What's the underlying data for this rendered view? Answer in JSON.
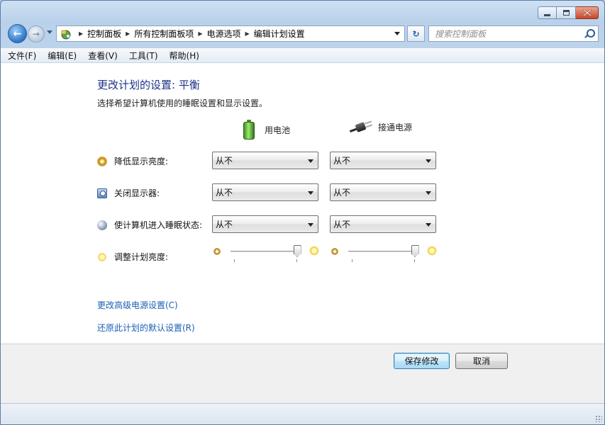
{
  "window": {
    "caption_buttons": [
      "minimize-icon",
      "maximize-icon",
      "close-icon"
    ]
  },
  "nav": {
    "back_icon": "back-arrow-icon",
    "forward_icon": "forward-arrow-icon",
    "breadcrumb": [
      "控制面板",
      "所有控制面板项",
      "电源选项",
      "编辑计划设置"
    ],
    "search_placeholder": "搜索控制面板"
  },
  "menu": [
    "文件(F)",
    "编辑(E)",
    "查看(V)",
    "工具(T)",
    "帮助(H)"
  ],
  "page": {
    "title": "更改计划的设置: 平衡",
    "subtitle": "选择希望计算机使用的睡眠设置和显示设置。",
    "col_battery": "用电池",
    "col_plugged": "接通电源"
  },
  "settings": [
    {
      "label": "降低显示亮度:",
      "icon": "dim-display-icon",
      "battery": "从不",
      "plugged": "从不"
    },
    {
      "label": "关闭显示器:",
      "icon": "monitor-off-icon",
      "battery": "从不",
      "plugged": "从不"
    },
    {
      "label": "使计算机进入睡眠状态:",
      "icon": "sleep-icon",
      "battery": "从不",
      "plugged": "从不"
    }
  ],
  "brightness": {
    "label": "调整计划亮度:",
    "battery_level": 1.0,
    "plugged_level": 1.0
  },
  "links": {
    "advanced": "更改高级电源设置(C)",
    "restore": "还原此计划的默认设置(R)"
  },
  "buttons": {
    "save": "保存修改",
    "cancel": "取消"
  },
  "colors": {
    "title": "#1e3287",
    "link": "#1a5fb4"
  }
}
